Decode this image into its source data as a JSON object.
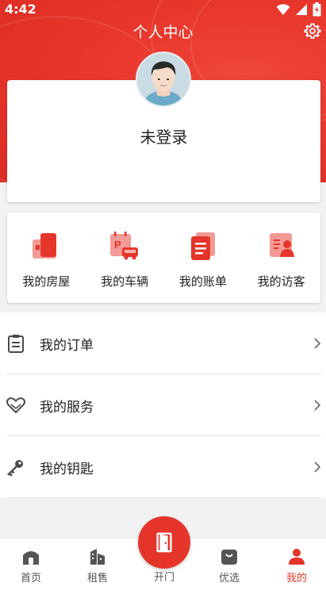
{
  "status_bar": {
    "time": "4:42"
  },
  "header": {
    "title": "个人中心"
  },
  "profile": {
    "login_status": "未登录"
  },
  "quick_actions": [
    {
      "label": "我的房屋",
      "icon": "house-icon"
    },
    {
      "label": "我的车辆",
      "icon": "parking-car-icon"
    },
    {
      "label": "我的账单",
      "icon": "bill-icon"
    },
    {
      "label": "我的访客",
      "icon": "visitor-icon"
    }
  ],
  "menu": [
    {
      "label": "我的订单",
      "icon": "clipboard-icon"
    },
    {
      "label": "我的服务",
      "icon": "heart-icon"
    },
    {
      "label": "我的钥匙",
      "icon": "key-icon"
    }
  ],
  "tabbar": {
    "tabs": [
      {
        "label": "首页",
        "icon": "home-icon"
      },
      {
        "label": "租售",
        "icon": "building-icon"
      },
      {
        "label": "开门",
        "icon": "door-icon"
      },
      {
        "label": "优选",
        "icon": "shopping-bag-icon"
      },
      {
        "label": "我的",
        "icon": "person-icon"
      }
    ],
    "active_index": 4
  },
  "colors": {
    "brand_red": "#e5352b",
    "icon_gray": "#4a4a4a"
  }
}
